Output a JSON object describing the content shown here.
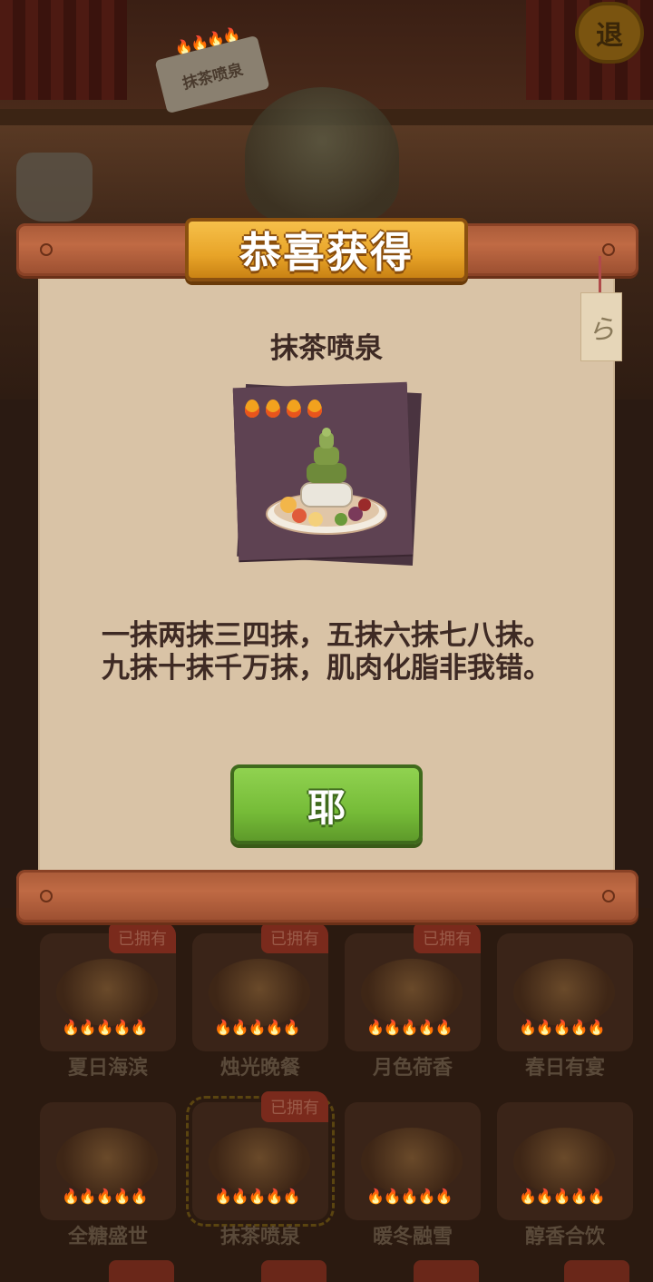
{
  "background": {
    "sign_label": "抹茶喷泉",
    "exit_label": "退",
    "grid": [
      {
        "name": "夏日海滨",
        "owned": "已拥有",
        "rating": 5
      },
      {
        "name": "烛光晚餐",
        "owned": "已拥有",
        "rating": 5
      },
      {
        "name": "月色荷香",
        "owned": "已拥有",
        "rating": 5
      },
      {
        "name": "春日有宴",
        "owned": "",
        "rating": 5
      },
      {
        "name": "全糖盛世",
        "owned": "",
        "rating": 5
      },
      {
        "name": "抹茶喷泉",
        "owned": "已拥有",
        "rating": 5
      },
      {
        "name": "暖冬融雪",
        "owned": "",
        "rating": 5
      },
      {
        "name": "醇香合饮",
        "owned": "",
        "rating": 5
      }
    ]
  },
  "modal": {
    "title": "恭喜获得",
    "item_name": "抹茶喷泉",
    "rating": 4,
    "description": "一抹两抹三四抹，五抹六抹七八抹。九抹十抹千万抹，肌肉化脂非我错。",
    "confirm_label": "耶",
    "tag_glyph": "ら"
  },
  "colors": {
    "paper": "#d9c3a6",
    "banner": "#e8a428",
    "button": "#76bc38",
    "text": "#3e2a24"
  }
}
